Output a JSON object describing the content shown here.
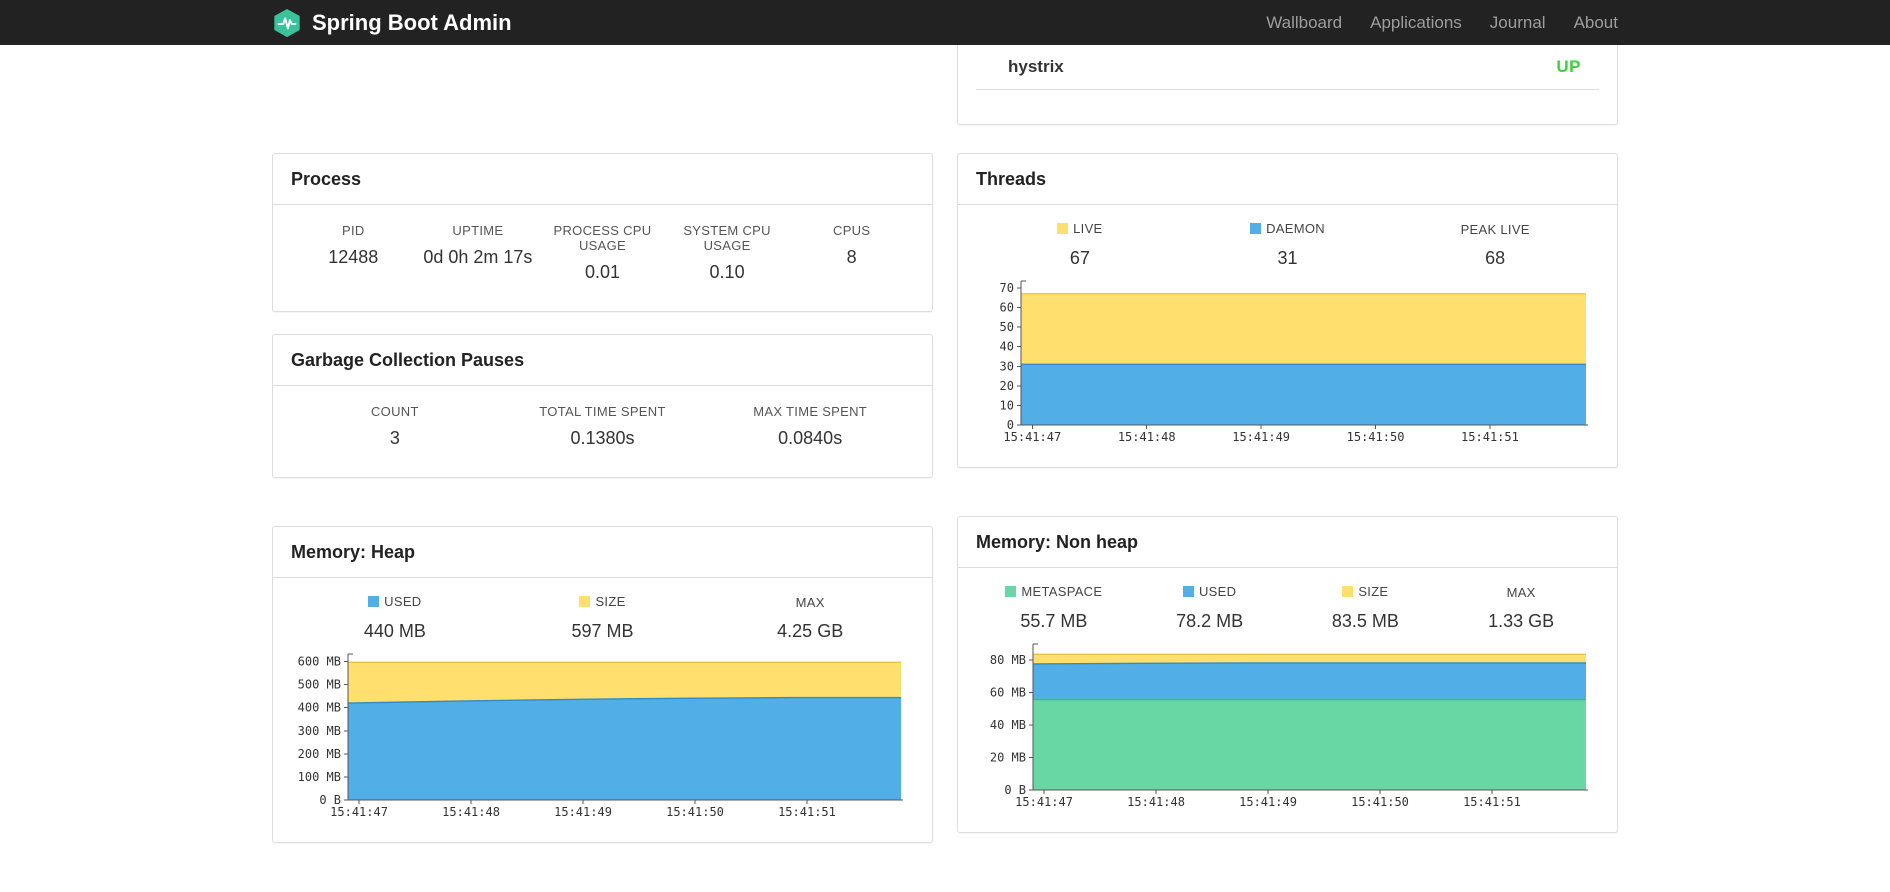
{
  "navbar": {
    "brand": "Spring Boot Admin",
    "links": [
      {
        "label": "Wallboard"
      },
      {
        "label": "Applications"
      },
      {
        "label": "Journal"
      },
      {
        "label": "About"
      }
    ]
  },
  "status_panel": {
    "app_name": "hystrix",
    "status": "UP",
    "status_color": "#3ecf3e"
  },
  "process": {
    "title": "Process",
    "metrics": [
      {
        "label": "PID",
        "value": "12488"
      },
      {
        "label": "UPTIME",
        "value": "0d 0h 2m 17s"
      },
      {
        "label": "PROCESS CPU USAGE",
        "value": "0.01"
      },
      {
        "label": "SYSTEM CPU USAGE",
        "value": "0.10"
      },
      {
        "label": "CPUS",
        "value": "8"
      }
    ]
  },
  "gc": {
    "title": "Garbage Collection Pauses",
    "metrics": [
      {
        "label": "COUNT",
        "value": "3"
      },
      {
        "label": "TOTAL TIME SPENT",
        "value": "0.1380s"
      },
      {
        "label": "MAX TIME SPENT",
        "value": "0.0840s"
      }
    ]
  },
  "threads": {
    "title": "Threads",
    "legend": [
      {
        "label": "LIVE",
        "value": "67",
        "color": "#ffe06e"
      },
      {
        "label": "DAEMON",
        "value": "31",
        "color": "#52aee6"
      },
      {
        "label": "PEAK LIVE",
        "value": "68"
      }
    ]
  },
  "heap": {
    "title": "Memory: Heap",
    "legend": [
      {
        "label": "USED",
        "value": "440 MB",
        "color": "#52aee6"
      },
      {
        "label": "SIZE",
        "value": "597 MB",
        "color": "#ffe06e"
      },
      {
        "label": "MAX",
        "value": "4.25 GB"
      }
    ]
  },
  "nonheap": {
    "title": "Memory: Non heap",
    "legend": [
      {
        "label": "METASPACE",
        "value": "55.7 MB",
        "color": "#69d7a4"
      },
      {
        "label": "USED",
        "value": "78.2 MB",
        "color": "#52aee6"
      },
      {
        "label": "SIZE",
        "value": "83.5 MB",
        "color": "#ffe06e"
      },
      {
        "label": "MAX",
        "value": "1.33 GB"
      }
    ]
  },
  "chart_data": [
    {
      "type": "area",
      "title": "Threads",
      "x": [
        "15:41:47",
        "15:41:48",
        "15:41:49",
        "15:41:50",
        "15:41:51"
      ],
      "ylim": [
        0,
        72
      ],
      "yticks": [
        {
          "v": 0,
          "label": "0"
        },
        {
          "v": 10,
          "label": "10"
        },
        {
          "v": 20,
          "label": "20"
        },
        {
          "v": 30,
          "label": "30"
        },
        {
          "v": 40,
          "label": "40"
        },
        {
          "v": 50,
          "label": "50"
        },
        {
          "v": 60,
          "label": "60"
        },
        {
          "v": 70,
          "label": "70"
        }
      ],
      "series": [
        {
          "name": "LIVE",
          "color": "#ffe06e",
          "stroke": "#e8c53f",
          "values": [
            67,
            67,
            67,
            67,
            67,
            67
          ]
        },
        {
          "name": "DAEMON",
          "color": "#52aee6",
          "stroke": "#2f8cc9",
          "values": [
            31,
            31,
            31,
            31,
            31,
            31
          ]
        }
      ]
    },
    {
      "type": "area",
      "title": "Memory: Heap",
      "x": [
        "15:41:47",
        "15:41:48",
        "15:41:49",
        "15:41:50",
        "15:41:51"
      ],
      "ylim": [
        0,
        620
      ],
      "yticks": [
        {
          "v": 0,
          "label": "0 B"
        },
        {
          "v": 100,
          "label": "100 MB"
        },
        {
          "v": 200,
          "label": "200 MB"
        },
        {
          "v": 300,
          "label": "300 MB"
        },
        {
          "v": 400,
          "label": "400 MB"
        },
        {
          "v": 500,
          "label": "500 MB"
        },
        {
          "v": 600,
          "label": "600 MB"
        }
      ],
      "series": [
        {
          "name": "SIZE",
          "color": "#ffe06e",
          "stroke": "#e8c53f",
          "values": [
            597,
            597,
            597,
            597,
            597,
            597
          ]
        },
        {
          "name": "USED",
          "color": "#52aee6",
          "stroke": "#2f8cc9",
          "values": [
            420,
            429,
            436,
            441,
            444,
            444
          ]
        }
      ]
    },
    {
      "type": "area",
      "title": "Memory: Non heap",
      "x": [
        "15:41:47",
        "15:41:48",
        "15:41:49",
        "15:41:50",
        "15:41:51"
      ],
      "ylim": [
        0,
        88
      ],
      "yticks": [
        {
          "v": 0,
          "label": "0 B"
        },
        {
          "v": 20,
          "label": "20 MB"
        },
        {
          "v": 40,
          "label": "40 MB"
        },
        {
          "v": 60,
          "label": "60 MB"
        },
        {
          "v": 80,
          "label": "80 MB"
        }
      ],
      "series": [
        {
          "name": "SIZE",
          "color": "#ffe06e",
          "stroke": "#e8c53f",
          "values": [
            83.5,
            83.5,
            83.5,
            83.5,
            83.5,
            83.5
          ]
        },
        {
          "name": "USED",
          "color": "#52aee6",
          "stroke": "#2f8cc9",
          "values": [
            77.6,
            78.0,
            78.2,
            78.2,
            78.2,
            78.2
          ]
        },
        {
          "name": "METASPACE",
          "color": "#69d7a4",
          "stroke": "#3fbd81",
          "values": [
            55.7,
            55.7,
            55.7,
            55.7,
            55.7,
            55.7
          ]
        }
      ]
    }
  ]
}
